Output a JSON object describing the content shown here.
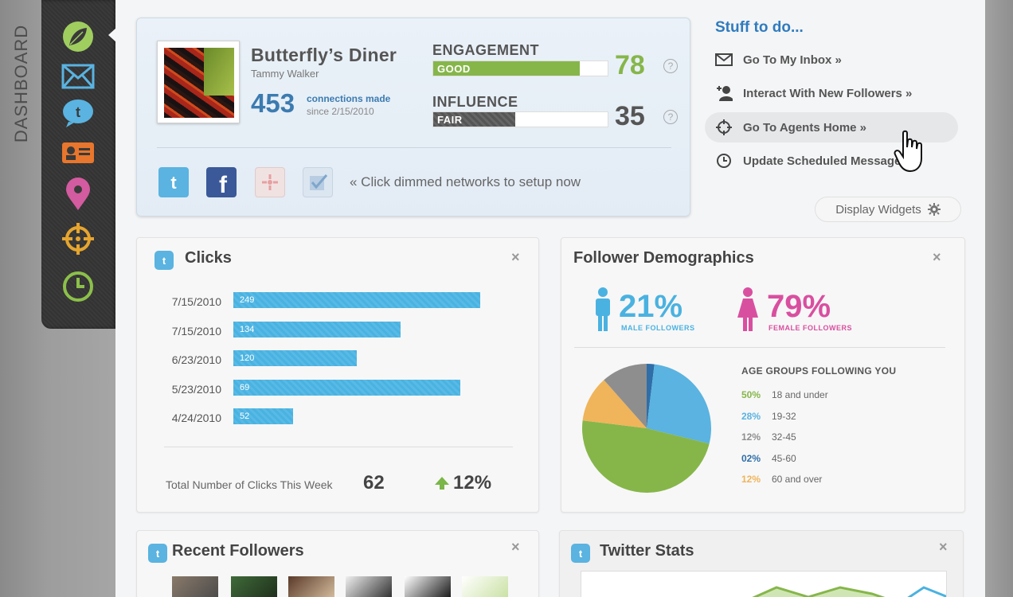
{
  "sidebar": {
    "label": "DASHBOARD",
    "items": [
      {
        "name": "leaf",
        "icon": "leaf-icon",
        "color": "#9fce5f"
      },
      {
        "name": "mail",
        "icon": "mail-icon",
        "color": "#5ab3e0"
      },
      {
        "name": "twitter",
        "icon": "twitter-bird-icon",
        "color": "#5ab3e0"
      },
      {
        "name": "contact",
        "icon": "contact-card-icon",
        "color": "#e8762c"
      },
      {
        "name": "location",
        "icon": "location-pin-icon",
        "color": "#d35b9f"
      },
      {
        "name": "target",
        "icon": "crosshair-icon",
        "color": "#e6a52f"
      },
      {
        "name": "clock",
        "icon": "clock-icon",
        "color": "#8cc04a"
      }
    ]
  },
  "profile": {
    "business_name": "Butterfly’s Diner",
    "owner": "Tammy Walker",
    "connections": "453",
    "connections_label": "connections made",
    "since": "since 2/15/2010",
    "engagement": {
      "title": "ENGAGEMENT",
      "rating": "GOOD",
      "score": "78",
      "level": 0.84,
      "color": "#86b64a"
    },
    "influence": {
      "title": "INFLUENCE",
      "rating": "FAIR",
      "score": "35",
      "level": 0.47,
      "color": "#555555"
    },
    "help": "?",
    "networks_hint": "« Click dimmed networks to setup now"
  },
  "todo": {
    "title": "Stuff to do...",
    "items": [
      {
        "label": "Go To My Inbox »",
        "icon": "envelope-icon"
      },
      {
        "label": "Interact With New Followers »",
        "icon": "add-person-icon"
      },
      {
        "label": "Go To Agents Home »",
        "icon": "crosshair-icon",
        "active": true
      },
      {
        "label": "Update Scheduled Messages",
        "icon": "clock-icon"
      }
    ],
    "display_widgets": "Display Widgets"
  },
  "clicks": {
    "title": "Clicks",
    "close": "×",
    "rows": [
      {
        "date": "7/15/2010",
        "value": "249",
        "level": 0.62
      },
      {
        "date": "7/15/2010",
        "value": "134",
        "level": 0.42
      },
      {
        "date": "6/23/2010",
        "value": "120",
        "level": 0.31
      },
      {
        "date": "5/23/2010",
        "value": "69",
        "level": 0.57
      },
      {
        "date": "4/24/2010",
        "value": "52",
        "level": 0.15
      }
    ],
    "total_label": "Total Number of Clicks This Week",
    "total": "62",
    "change": "12%"
  },
  "demographics": {
    "title": "Follower Demographics",
    "close": "×",
    "male_pct": "21%",
    "male_label": "MALE FOLLOWERS",
    "female_pct": "79%",
    "female_label": "FEMALE FOLLOWERS",
    "age_title": "AGE GROUPS FOLLOWING YOU",
    "ages": [
      {
        "pct": "50%",
        "label": "18 and under",
        "color": "#86b64a",
        "value": 50
      },
      {
        "pct": "28%",
        "label": "19-32",
        "color": "#5ab3e0",
        "value": 28
      },
      {
        "pct": "12%",
        "label": "32-45",
        "color": "#8e8e8e",
        "value": 12
      },
      {
        "pct": "02%",
        "label": "45-60",
        "color": "#2f6ea8",
        "value": 2
      },
      {
        "pct": "12%",
        "label": "60 and over",
        "color": "#f0b45a",
        "value": 12
      }
    ]
  },
  "recent_followers": {
    "title": "Recent Followers",
    "close": "×"
  },
  "twitter_stats": {
    "title": "Twitter Stats",
    "close": "×"
  }
}
